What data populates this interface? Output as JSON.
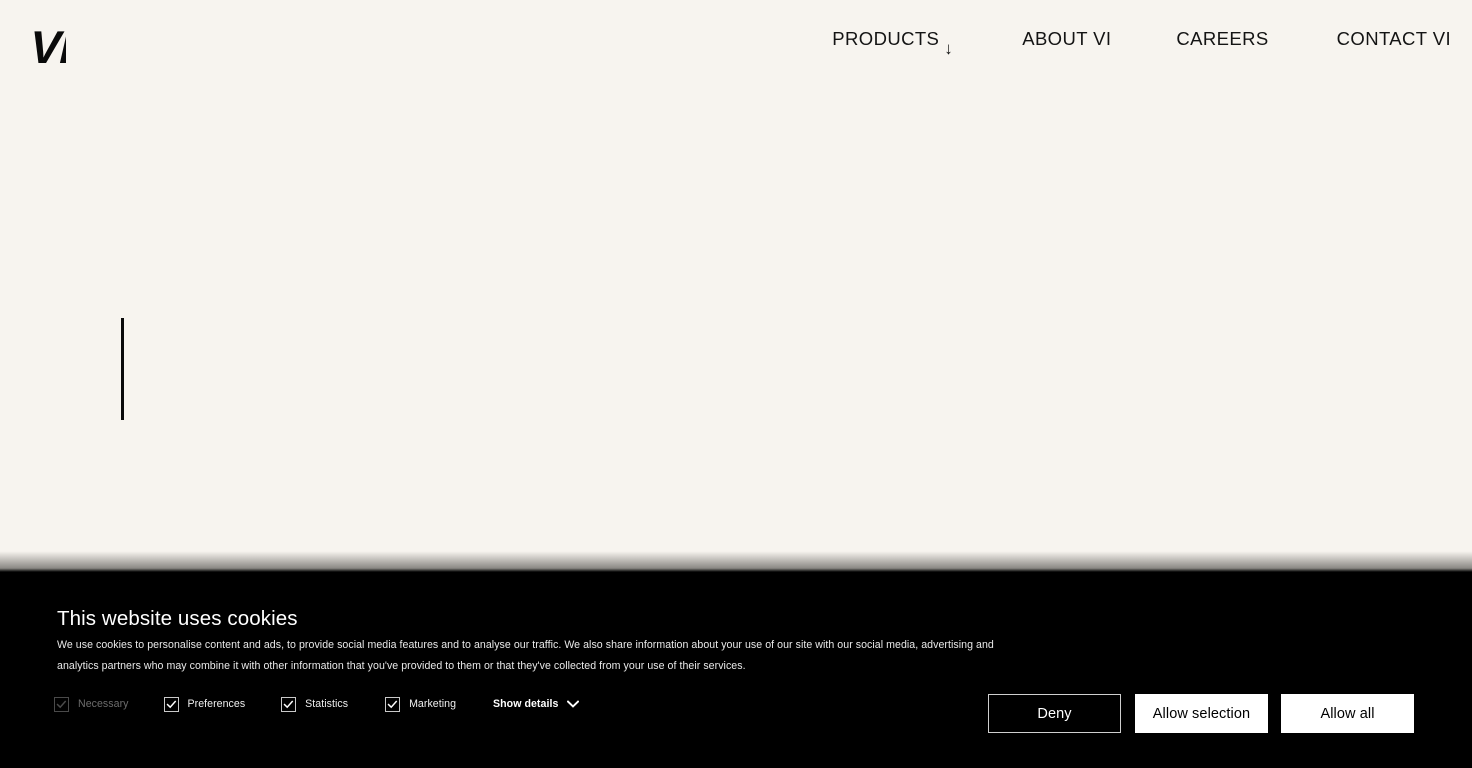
{
  "theme": {
    "page_background": "#f7f4ef",
    "text_color": "#141414",
    "banner_background": "#000000",
    "banner_text": "#ffffff",
    "button_light": "#ffffff",
    "checkbox_border": "#c9c9c9",
    "disabled_color": "#6d6d6d"
  },
  "header": {
    "logo_text": "VI",
    "logo_icon": "vi-wordmark-logo",
    "nav": [
      {
        "label": "PRODUCTS",
        "has_dropdown": true,
        "arrow_icon": "arrow-down-icon",
        "arrow_glyph": "↓"
      },
      {
        "label": "ABOUT VI",
        "has_dropdown": false
      },
      {
        "label": "CAREERS",
        "has_dropdown": false
      },
      {
        "label": "CONTACT VI",
        "has_dropdown": false
      }
    ]
  },
  "hero": {
    "caret_visible": true,
    "caret_name": "text-cursor-caret"
  },
  "cookie_banner": {
    "title": "This website uses cookies",
    "body": "We use cookies to personalise content and ads, to provide social media features and to analyse our traffic. We also share information about your use of our site with our social media, advertising and analytics partners who may combine it with other information that you've provided to them or that they've collected from your use of their services.",
    "options": [
      {
        "label": "Necessary",
        "checked": true,
        "disabled": true
      },
      {
        "label": "Preferences",
        "checked": true,
        "disabled": false
      },
      {
        "label": "Statistics",
        "checked": true,
        "disabled": false
      },
      {
        "label": "Marketing",
        "checked": true,
        "disabled": false
      }
    ],
    "show_details": {
      "label": "Show details",
      "icon": "chevron-down-icon",
      "expanded": false
    },
    "buttons": [
      {
        "label": "Deny",
        "style": "outline"
      },
      {
        "label": "Allow selection",
        "style": "light"
      },
      {
        "label": "Allow all",
        "style": "light"
      }
    ]
  }
}
